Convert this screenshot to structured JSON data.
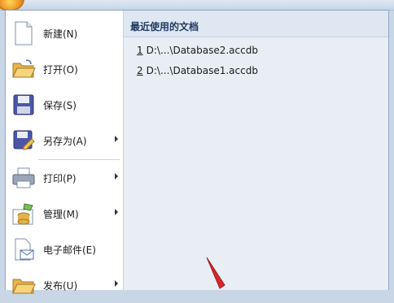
{
  "menu": {
    "items": [
      {
        "label": "新建(N)",
        "icon": "new-document-icon",
        "submenu": false
      },
      {
        "label": "打开(O)",
        "icon": "open-folder-icon",
        "submenu": false
      },
      {
        "label": "保存(S)",
        "icon": "save-disk-icon",
        "submenu": false
      },
      {
        "label": "另存为(A)",
        "icon": "save-as-icon",
        "submenu": true
      },
      {
        "label": "打印(P)",
        "icon": "printer-icon",
        "submenu": true
      },
      {
        "label": "管理(M)",
        "icon": "manage-database-icon",
        "submenu": true
      },
      {
        "label": "电子邮件(E)",
        "icon": "email-icon",
        "submenu": false
      },
      {
        "label": "发布(U)",
        "icon": "publish-folder-icon",
        "submenu": true
      }
    ]
  },
  "recent": {
    "title": "最近使用的文档",
    "files": [
      {
        "num": "1",
        "path": "D:\\...\\Database2.accdb"
      },
      {
        "num": "2",
        "path": "D:\\...\\Database1.accdb"
      }
    ]
  },
  "colors": {
    "accent_red": "#d8262a",
    "title_blue": "#1f3a63"
  }
}
